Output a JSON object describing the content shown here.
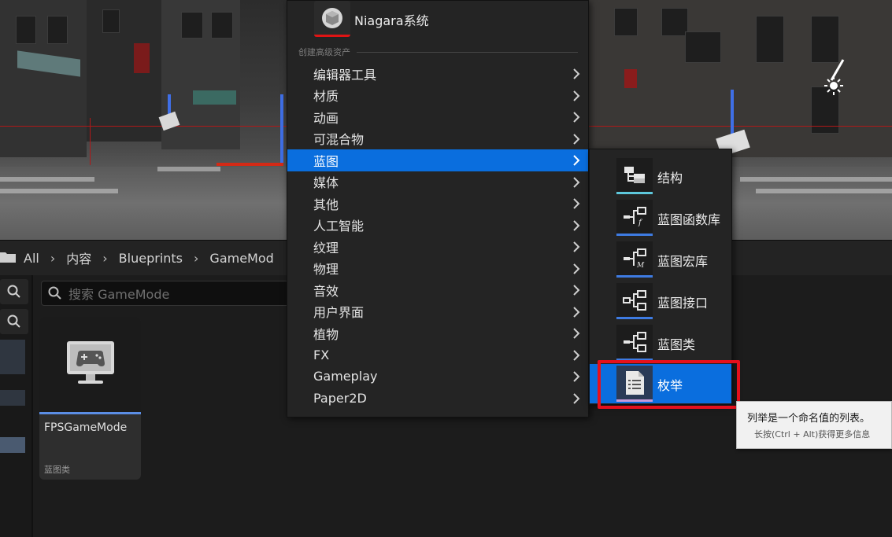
{
  "menu": {
    "niagara": {
      "label": "Niagara系统",
      "icon": "niagara-icon"
    },
    "section_header": "创建高级资产",
    "items": [
      {
        "label": "编辑器工具",
        "active": false
      },
      {
        "label": "材质",
        "active": false
      },
      {
        "label": "动画",
        "active": false
      },
      {
        "label": "可混合物",
        "active": false
      },
      {
        "label": "蓝图",
        "active": true
      },
      {
        "label": "媒体",
        "active": false
      },
      {
        "label": "其他",
        "active": false
      },
      {
        "label": "人工智能",
        "active": false
      },
      {
        "label": "纹理",
        "active": false
      },
      {
        "label": "物理",
        "active": false
      },
      {
        "label": "音效",
        "active": false
      },
      {
        "label": "用户界面",
        "active": false
      },
      {
        "label": "植物",
        "active": false
      },
      {
        "label": "FX",
        "active": false
      },
      {
        "label": "Gameplay",
        "active": false
      },
      {
        "label": "Paper2D",
        "active": false
      }
    ],
    "active_color": "#0a6ede"
  },
  "submenu": {
    "items": [
      {
        "label": "结构",
        "icon": "struct-icon",
        "accent": "#5ec8dc"
      },
      {
        "label": "蓝图函数库",
        "icon": "function-library-icon",
        "accent": "#3e7be2"
      },
      {
        "label": "蓝图宏库",
        "icon": "macro-library-icon",
        "accent": "#3e7be2"
      },
      {
        "label": "蓝图接口",
        "icon": "interface-icon",
        "accent": "#3e7be2"
      },
      {
        "label": "蓝图类",
        "icon": "blueprint-class-icon",
        "accent": "#3e7be2"
      },
      {
        "label": "枚举",
        "icon": "enum-icon",
        "accent": "#c89ad8",
        "active": true
      }
    ]
  },
  "tooltip": {
    "text": "列举是一个命名值的列表。",
    "hint": "长按(Ctrl + Alt)获得更多信息"
  },
  "browser": {
    "breadcrumb": [
      "All",
      "内容",
      "Blueprints",
      "GameMod"
    ],
    "search_placeholder": "搜索 GameMode",
    "asset": {
      "name": "FPSGameMode",
      "type": "蓝图类",
      "icon": "gamepad-monitor-icon"
    }
  },
  "highlight_color": "#e5101c"
}
